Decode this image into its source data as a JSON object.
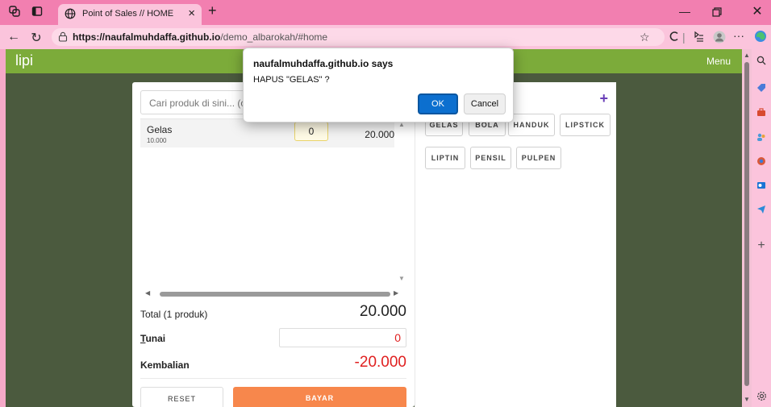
{
  "browser": {
    "tab_title": "Point of Sales // HOME",
    "tab_close": "×",
    "new_tab": "+",
    "url_host": "https://naufalmuhdaffa.github.io",
    "url_path": "/demo_albarokah/#home",
    "icons": [
      "workspaces-icon",
      "tab-actions-icon",
      "back-icon",
      "refresh-icon",
      "lock-icon",
      "favorite-icon",
      "copilot-icon",
      "collections-icon",
      "profile-icon",
      "more-icon",
      "edge-icon",
      "minimize-icon",
      "restore-icon",
      "close-icon"
    ]
  },
  "app": {
    "brand": "lipi",
    "menu": "Menu"
  },
  "pos": {
    "search_placeholder": "Cari produk di sini... (ctrl",
    "items": [
      {
        "name": "Gelas",
        "price": "10.000",
        "qty": "0",
        "subtotal": "20.000"
      }
    ],
    "total_label": "Total (1 produk)",
    "total_value": "20.000",
    "tunai_label_underlined": "T",
    "tunai_label_rest": "unai",
    "tunai_value": "0",
    "kembalian_label": "Kembalian",
    "kembalian_value": "-20.000",
    "reset_label": "RESET",
    "bayar_label": "BAYAR"
  },
  "products": {
    "add_icon": "+",
    "chips": [
      "GELAS",
      "BOLA",
      "HANDUK",
      "LIPSTICK",
      "LIPTIN",
      "PENSIL",
      "PULPEN"
    ]
  },
  "dialog": {
    "title": "naufalmuhdaffa.github.io says",
    "message": "HAPUS \"GELAS\" ?",
    "ok": "OK",
    "cancel": "Cancel"
  },
  "sidebar": {
    "plus": "+"
  },
  "colors": {
    "titlebar": "#f27fb0",
    "appbar": "#7cab3a",
    "page_bg": "#4b5a3e",
    "bayar": "#f7874c",
    "negative": "#e02020",
    "ok_button": "#0c6fcf"
  }
}
